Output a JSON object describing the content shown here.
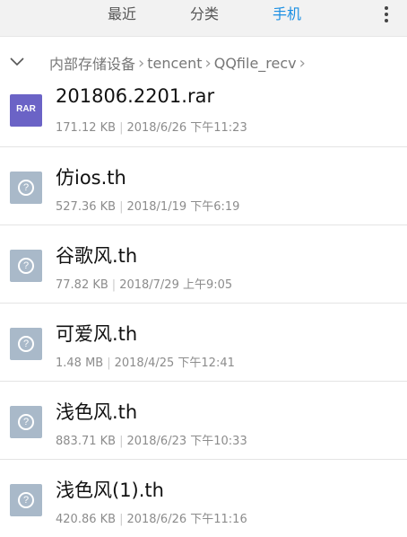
{
  "tabs": [
    {
      "label": "最近",
      "active": false
    },
    {
      "label": "分类",
      "active": false
    },
    {
      "label": "手机",
      "active": true
    }
  ],
  "accent_color": "#1a8fe3",
  "breadcrumb": [
    "内部存储设备",
    "tencent",
    "QQfile_recv"
  ],
  "files": [
    {
      "name": "201806.2201.rar",
      "size": "171.12 KB",
      "date": "2018/6/26 下午11:23",
      "icon": "rar-icon",
      "icon_label": "RAR"
    },
    {
      "name": "仿ios.th",
      "size": "527.36 KB",
      "date": "2018/1/19 下午6:19",
      "icon": "unknown-file-icon"
    },
    {
      "name": "谷歌风.th",
      "size": "77.82 KB",
      "date": "2018/7/29 上午9:05",
      "icon": "unknown-file-icon"
    },
    {
      "name": "可爱风.th",
      "size": "1.48 MB",
      "date": "2018/4/25 下午12:41",
      "icon": "unknown-file-icon"
    },
    {
      "name": "浅色风.th",
      "size": "883.71 KB",
      "date": "2018/6/23 下午10:33",
      "icon": "unknown-file-icon"
    },
    {
      "name": "浅色风(1).th",
      "size": "420.86 KB",
      "date": "2018/6/26 下午11:16",
      "icon": "unknown-file-icon"
    }
  ]
}
